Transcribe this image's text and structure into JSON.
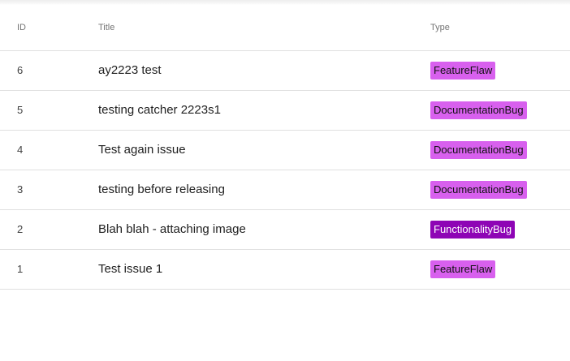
{
  "table": {
    "headers": {
      "id": "ID",
      "title": "Title",
      "type": "Type"
    },
    "rows": [
      {
        "id": "6",
        "title": "ay2223 test",
        "type": "FeatureFlaw",
        "type_style": "light"
      },
      {
        "id": "5",
        "title": "testing catcher 2223s1",
        "type": "DocumentationBug",
        "type_style": "light"
      },
      {
        "id": "4",
        "title": "Test again issue",
        "type": "DocumentationBug",
        "type_style": "light"
      },
      {
        "id": "3",
        "title": "testing before releasing",
        "type": "DocumentationBug",
        "type_style": "light"
      },
      {
        "id": "2",
        "title": "Blah blah - attaching image",
        "type": "FunctionalityBug",
        "type_style": "dark"
      },
      {
        "id": "1",
        "title": "Test issue 1",
        "type": "FeatureFlaw",
        "type_style": "light"
      }
    ]
  },
  "colors": {
    "badge_light": "#d860ee",
    "badge_dark": "#8e05b5",
    "divider": "#e0e0e0",
    "header_text": "#757575"
  }
}
